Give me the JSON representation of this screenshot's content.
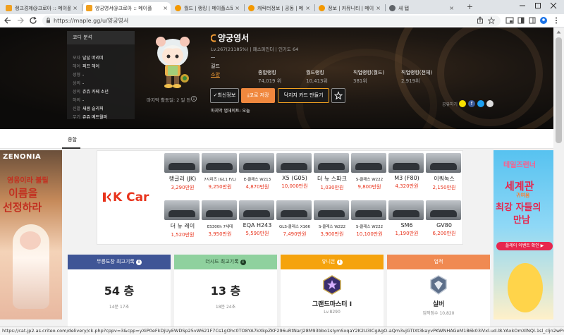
{
  "browser": {
    "tabs": [
      {
        "title": "랭크경제@크로아 :: 메이플",
        "color": "#f0a020",
        "active": false
      },
      {
        "title": "양궁영서@크로아 :: 메이플",
        "color": "#f0a020",
        "active": true
      },
      {
        "title": "월드 | 랭킹 | 메이플스토리",
        "color": "#f39800",
        "active": false
      },
      {
        "title": "캐릭터정보 | 공동 | 메이플",
        "color": "#f39800",
        "active": false
      },
      {
        "title": "정보 | 커뮤니티 | 메이플스",
        "color": "#f39800",
        "active": false
      },
      {
        "title": "새 탭",
        "color": "#5f6368",
        "active": false
      }
    ],
    "tab_close": "×",
    "new_tab": "+",
    "url": "https://maple.gg/u/양궁영서",
    "status_url": "https://cat.jp2.as.criteo.com/delivery/ck.php?cppv=3&cpp=yXiP0eFkDjUyEWDSp25vW621F7Cs1gOhc0TO8YA7kXkpZKF296uRtNarJ28M93bbo1sIymSxqaY2K2U3ICgAgO-aQm3vjGTIXt3kayvPKWNHAGeM1B6k03iVxl.ud.l8-YAxkOmXlNQl.1sl_cljn2wP49FjhcYGndG6W1cZrd..."
  },
  "codi": {
    "title": "코디 분석",
    "rows": [
      {
        "k": "모자",
        "v": "달달 머리띠"
      },
      {
        "k": "헤어",
        "v": "퍼프 헤어"
      },
      {
        "k": "성형",
        "v": "-"
      },
      {
        "k": "상의",
        "v": "-"
      },
      {
        "k": "상의",
        "v": "쥬쥬 카페 소년"
      },
      {
        "k": "하의",
        "v": "-"
      },
      {
        "k": "신발",
        "v": "새콤 슬리퍼"
      },
      {
        "k": "무기",
        "v": "쥬쥬 메트월퍼"
      }
    ]
  },
  "profile": {
    "last_active": "마지막 활동일: 2 일 전",
    "name": "양궁영서",
    "level_line": "Lv.267(21185%)",
    "job": "패스파인더",
    "popularity": "인기도 64",
    "guild_label": "길드",
    "guild_value": "소양",
    "stats": [
      {
        "label": "종합랭킹",
        "value": "74,019 위"
      },
      {
        "label": "월드랭킹",
        "value": "10,413위"
      },
      {
        "label": "직업랭킹(월드)",
        "value": "381위"
      },
      {
        "label": "직업랭킹(전체)",
        "value": "2,919위"
      }
    ],
    "btn_refresh": "최신정보",
    "btn_codi": "코로 저장",
    "btn_card": "닥지지 카드 만들기",
    "updated": "마지막 업데이트: 오늘",
    "share_label": "공유하기"
  },
  "page_tab": "종합",
  "ad": {
    "brand": "K Car",
    "cars": [
      {
        "name": "랭글러 (JK)",
        "price": "3,290만원",
        "small": false
      },
      {
        "name": "7시리즈 (G11 F/L)",
        "price": "9,250만원",
        "small": true
      },
      {
        "name": "E-클래스 W213",
        "price": "4,870만원",
        "small": true
      },
      {
        "name": "X5 (G05)",
        "price": "10,000만원",
        "small": false
      },
      {
        "name": "더 뉴 스파크",
        "price": "1,030만원",
        "small": false
      },
      {
        "name": "S-클래스 W222",
        "price": "9,800만원",
        "small": true
      },
      {
        "name": "M3 (F80)",
        "price": "4,320만원",
        "small": false
      },
      {
        "name": "이쿼녹스",
        "price": "2,150만원",
        "small": false
      },
      {
        "name": "더 뉴 레이",
        "price": "1,520만원",
        "small": false
      },
      {
        "name": "ES300h 7세대",
        "price": "3,950만원",
        "small": true
      },
      {
        "name": "EQA H243",
        "price": "5,590만원",
        "small": false
      },
      {
        "name": "GLS-클래스 X166",
        "price": "7,490만원",
        "small": true
      },
      {
        "name": "S-클래스 W222",
        "price": "3,900만원",
        "small": true
      },
      {
        "name": "S-클래스 W222",
        "price": "10,100만원",
        "small": true
      },
      {
        "name": "SM6",
        "price": "1,190만원",
        "small": false
      },
      {
        "name": "GV80",
        "price": "6,200만원",
        "small": false
      }
    ],
    "left": {
      "brand": "ZENONIA",
      "line1": "영웅이라 불릴",
      "line2": "이름을",
      "line3": "선정하라"
    },
    "right": {
      "brand": "테일즈런너",
      "line1": "세계관",
      "line2": "귀여움",
      "line3": "최강 자들의",
      "line4": "만남",
      "cta": "플레이 이벤트 확인 ▶"
    }
  },
  "cards": [
    {
      "title": "무릉도장 최고기록",
      "big": "54 층",
      "sub": "14분 17초",
      "color": "#3f5596"
    },
    {
      "title": "더시드 최고기록",
      "big": "13 층",
      "sub": "18분 24초",
      "color": "#8fd19e"
    },
    {
      "title": "유니온",
      "big": "그랜드마스터 I",
      "sub": "Lv.8290",
      "color": "#f5a30d"
    },
    {
      "title": "업적",
      "big": "실버",
      "sub": "업적점수 10,820",
      "color": "#f08a52"
    }
  ],
  "info_mark": "i"
}
